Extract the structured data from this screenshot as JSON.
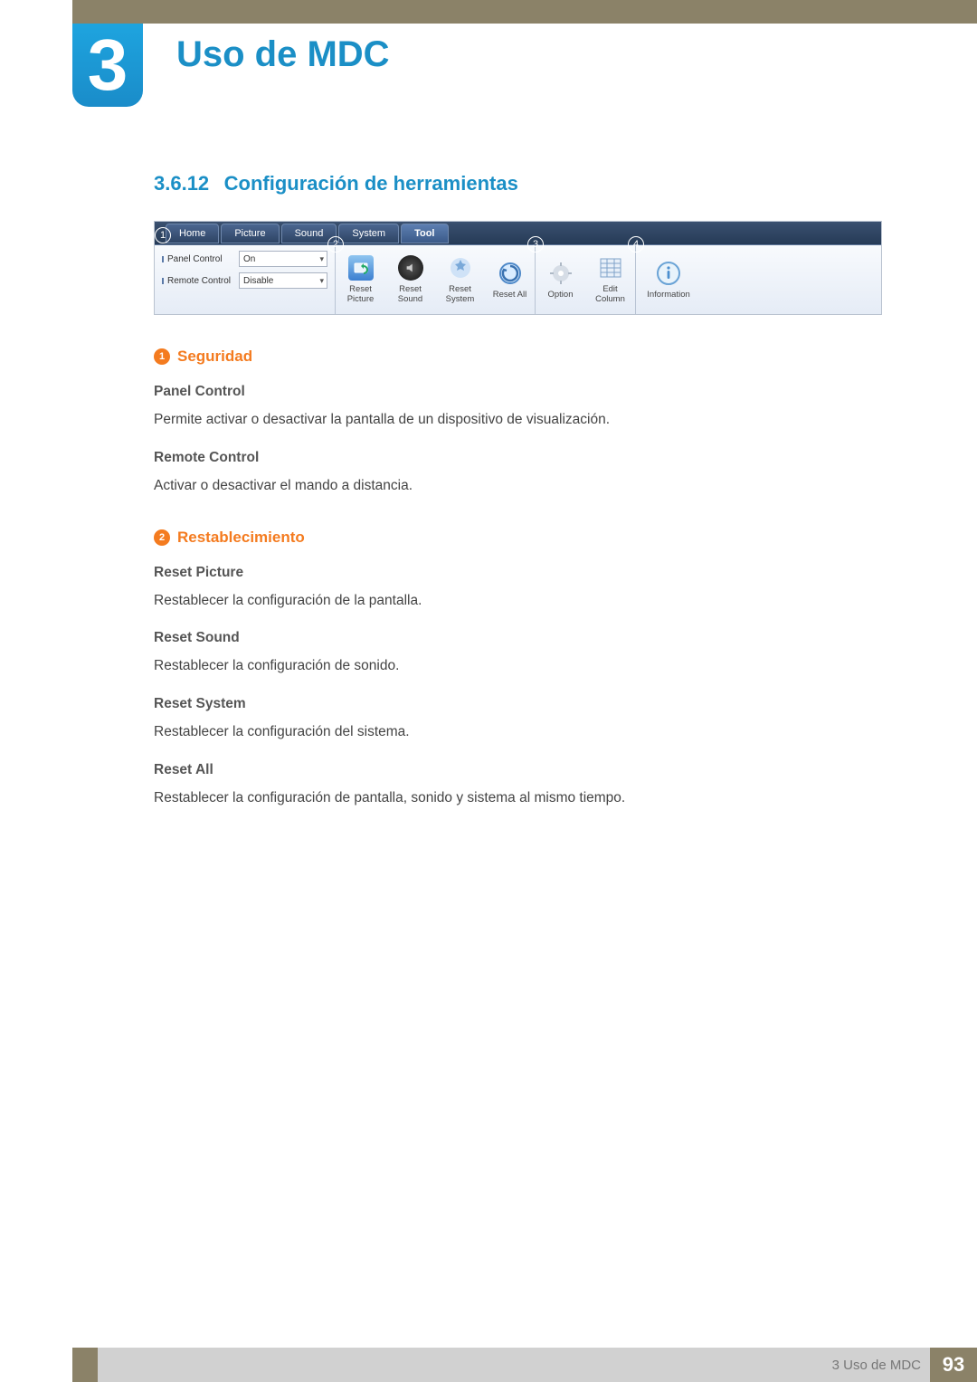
{
  "chapter": {
    "number": "3",
    "title": "Uso de MDC"
  },
  "section": {
    "number": "3.6.12",
    "title": "Configuración de herramientas"
  },
  "screenshot": {
    "tabs": [
      "Home",
      "Picture",
      "Sound",
      "System",
      "Tool"
    ],
    "active_tab_index": 4,
    "callouts": [
      "1",
      "2",
      "3",
      "4"
    ],
    "panel_controls": [
      {
        "label": "Panel Control",
        "value": "On"
      },
      {
        "label": "Remote Control",
        "value": "Disable"
      }
    ],
    "reset_buttons": [
      "Reset Picture",
      "Reset Sound",
      "Reset System",
      "Reset All"
    ],
    "option_button": "Option",
    "edit_column_button": "Edit Column",
    "info_button": "Information"
  },
  "sub1": {
    "num": "1",
    "title": "Seguridad",
    "items": [
      {
        "title": "Panel Control",
        "text": "Permite activar o desactivar la pantalla de un dispositivo de visualización."
      },
      {
        "title": "Remote Control",
        "text": "Activar o desactivar el mando a distancia."
      }
    ]
  },
  "sub2": {
    "num": "2",
    "title": "Restablecimiento",
    "items": [
      {
        "title": "Reset Picture",
        "text": "Restablecer la configuración de la pantalla."
      },
      {
        "title": "Reset Sound",
        "text": "Restablecer la configuración de sonido."
      },
      {
        "title": "Reset System",
        "text": "Restablecer la configuración del sistema."
      },
      {
        "title": "Reset All",
        "text": "Restablecer la configuración de pantalla, sonido y sistema al mismo tiempo."
      }
    ]
  },
  "footer": {
    "text": "3 Uso de MDC",
    "page": "93"
  }
}
